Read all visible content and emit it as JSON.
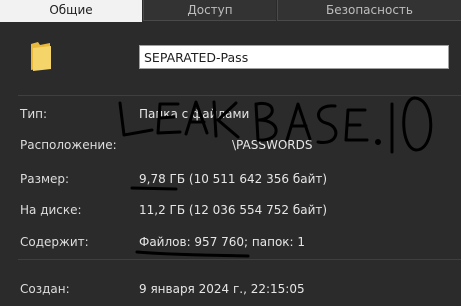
{
  "tabs": [
    {
      "label": "Общие"
    },
    {
      "label": "Доступ"
    },
    {
      "label": "Безопасность"
    }
  ],
  "name_field": {
    "value": "SEPARATED-Pass"
  },
  "rows": {
    "type": {
      "label": "Тип:",
      "value": "Папка с файлами"
    },
    "location": {
      "label": "Расположение:",
      "value": "\\PASSWORDS"
    },
    "size": {
      "label": "Размер:",
      "value": "9,78 ГБ (10 511 642 356 байт)"
    },
    "on_disk": {
      "label": "На диске:",
      "value": "11,2 ГБ (12 036 554 752 байт)"
    },
    "contains": {
      "label": "Содержит:",
      "value": "Файлов: 957 760; папок: 1"
    },
    "created": {
      "label": "Создан:",
      "value": "9 января 2024 г., 22:15:05"
    }
  },
  "annotation": {
    "text": "LEAKBASE.IO",
    "color": "#000000"
  },
  "colors": {
    "background": "#2b2b2b",
    "folder": "#f2c94c",
    "active_tab": "#f2f2f2"
  },
  "icons": {
    "folder": "folder-icon"
  }
}
